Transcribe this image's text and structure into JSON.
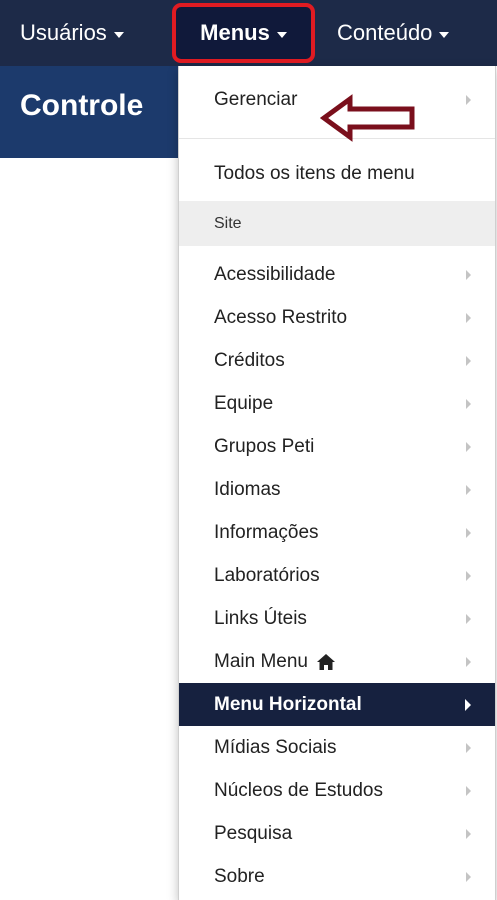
{
  "navbar": {
    "users_label": "Usuários",
    "menus_label": "Menus",
    "content_label": "Conteúdo"
  },
  "subheader": {
    "title": "Controle"
  },
  "dropdown": {
    "manage": "Gerenciar",
    "all_items": "Todos os itens de menu",
    "section_header": "Site",
    "items": [
      {
        "label": "Acessibilidade"
      },
      {
        "label": "Acesso Restrito"
      },
      {
        "label": "Créditos"
      },
      {
        "label": "Equipe"
      },
      {
        "label": "Grupos Peti"
      },
      {
        "label": "Idiomas"
      },
      {
        "label": "Informações"
      },
      {
        "label": "Laboratórios"
      },
      {
        "label": "Links Úteis"
      },
      {
        "label": "Main Menu",
        "icon": "home-icon"
      },
      {
        "label": "Menu Horizontal",
        "active": true
      },
      {
        "label": "Mídias Sociais"
      },
      {
        "label": "Núcleos de Estudos"
      },
      {
        "label": "Pesquisa"
      },
      {
        "label": "Sobre"
      }
    ]
  },
  "colors": {
    "navbar_bg": "#1d2a48",
    "highlight_border": "#e01b22",
    "active_item_bg": "#16213f",
    "annotation_arrow": "#7a0f1c"
  }
}
